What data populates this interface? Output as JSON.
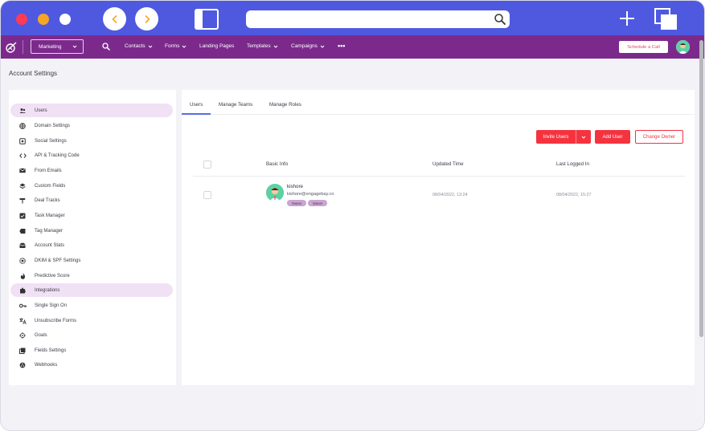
{
  "app": {
    "product_select": "Marketing",
    "nav": [
      "Contacts",
      "Forms",
      "Landing Pages",
      "Templates",
      "Campaigns"
    ],
    "schedule_label": "Schedule a Call"
  },
  "page": {
    "title": "Account Settings"
  },
  "menu": [
    {
      "label": "Users",
      "icon": "users-icon",
      "active": true
    },
    {
      "label": "Domain Settings",
      "icon": "globe-icon",
      "active": false
    },
    {
      "label": "Social Settings",
      "icon": "social-icon",
      "active": false
    },
    {
      "label": "API & Tracking Code",
      "icon": "code-icon",
      "active": false
    },
    {
      "label": "From Emails",
      "icon": "mail-icon",
      "active": false
    },
    {
      "label": "Custom Fields",
      "icon": "layers-icon",
      "active": false
    },
    {
      "label": "Deal Tracks",
      "icon": "signpost-icon",
      "active": false
    },
    {
      "label": "Task Manager",
      "icon": "task-icon",
      "active": false
    },
    {
      "label": "Tag Manager",
      "icon": "tag-icon",
      "active": false
    },
    {
      "label": "Account Stats",
      "icon": "inbox-icon",
      "active": false
    },
    {
      "label": "DKIM & SPF Settings",
      "icon": "gear-icon",
      "active": false
    },
    {
      "label": "Predictive Score",
      "icon": "fire-icon",
      "active": false
    },
    {
      "label": "Integrations",
      "icon": "puzzle-icon",
      "active": true
    },
    {
      "label": "Single Sign On",
      "icon": "key-icon",
      "active": false
    },
    {
      "label": "Unsubscribe Forms",
      "icon": "translate-icon",
      "active": false
    },
    {
      "label": "Goals",
      "icon": "target-icon",
      "active": false
    },
    {
      "label": "Fields Settings",
      "icon": "fields-icon",
      "active": false
    },
    {
      "label": "Webhooks",
      "icon": "webhook-icon",
      "active": false
    }
  ],
  "tabs": [
    "Users",
    "Manage Teams",
    "Manage Roles"
  ],
  "actions": {
    "invite": "Invite Users",
    "add": "Add User",
    "change_owner": "Change Owner"
  },
  "table": {
    "columns": [
      "Basic Info",
      "Updated Time",
      "Last Logged In"
    ],
    "rows": [
      {
        "name": "kishore",
        "email": "kishore@engagebay.co",
        "badges": [
          "Owner",
          "Owner"
        ],
        "updated": "08/04/2022, 13:24",
        "last_login": "08/04/2022, 15:27"
      }
    ]
  },
  "colors": {
    "chrome": "#4f59e0",
    "appnav": "#7b2a8c",
    "accent": "#f5333f",
    "active_menu": "#f1e1f5"
  }
}
